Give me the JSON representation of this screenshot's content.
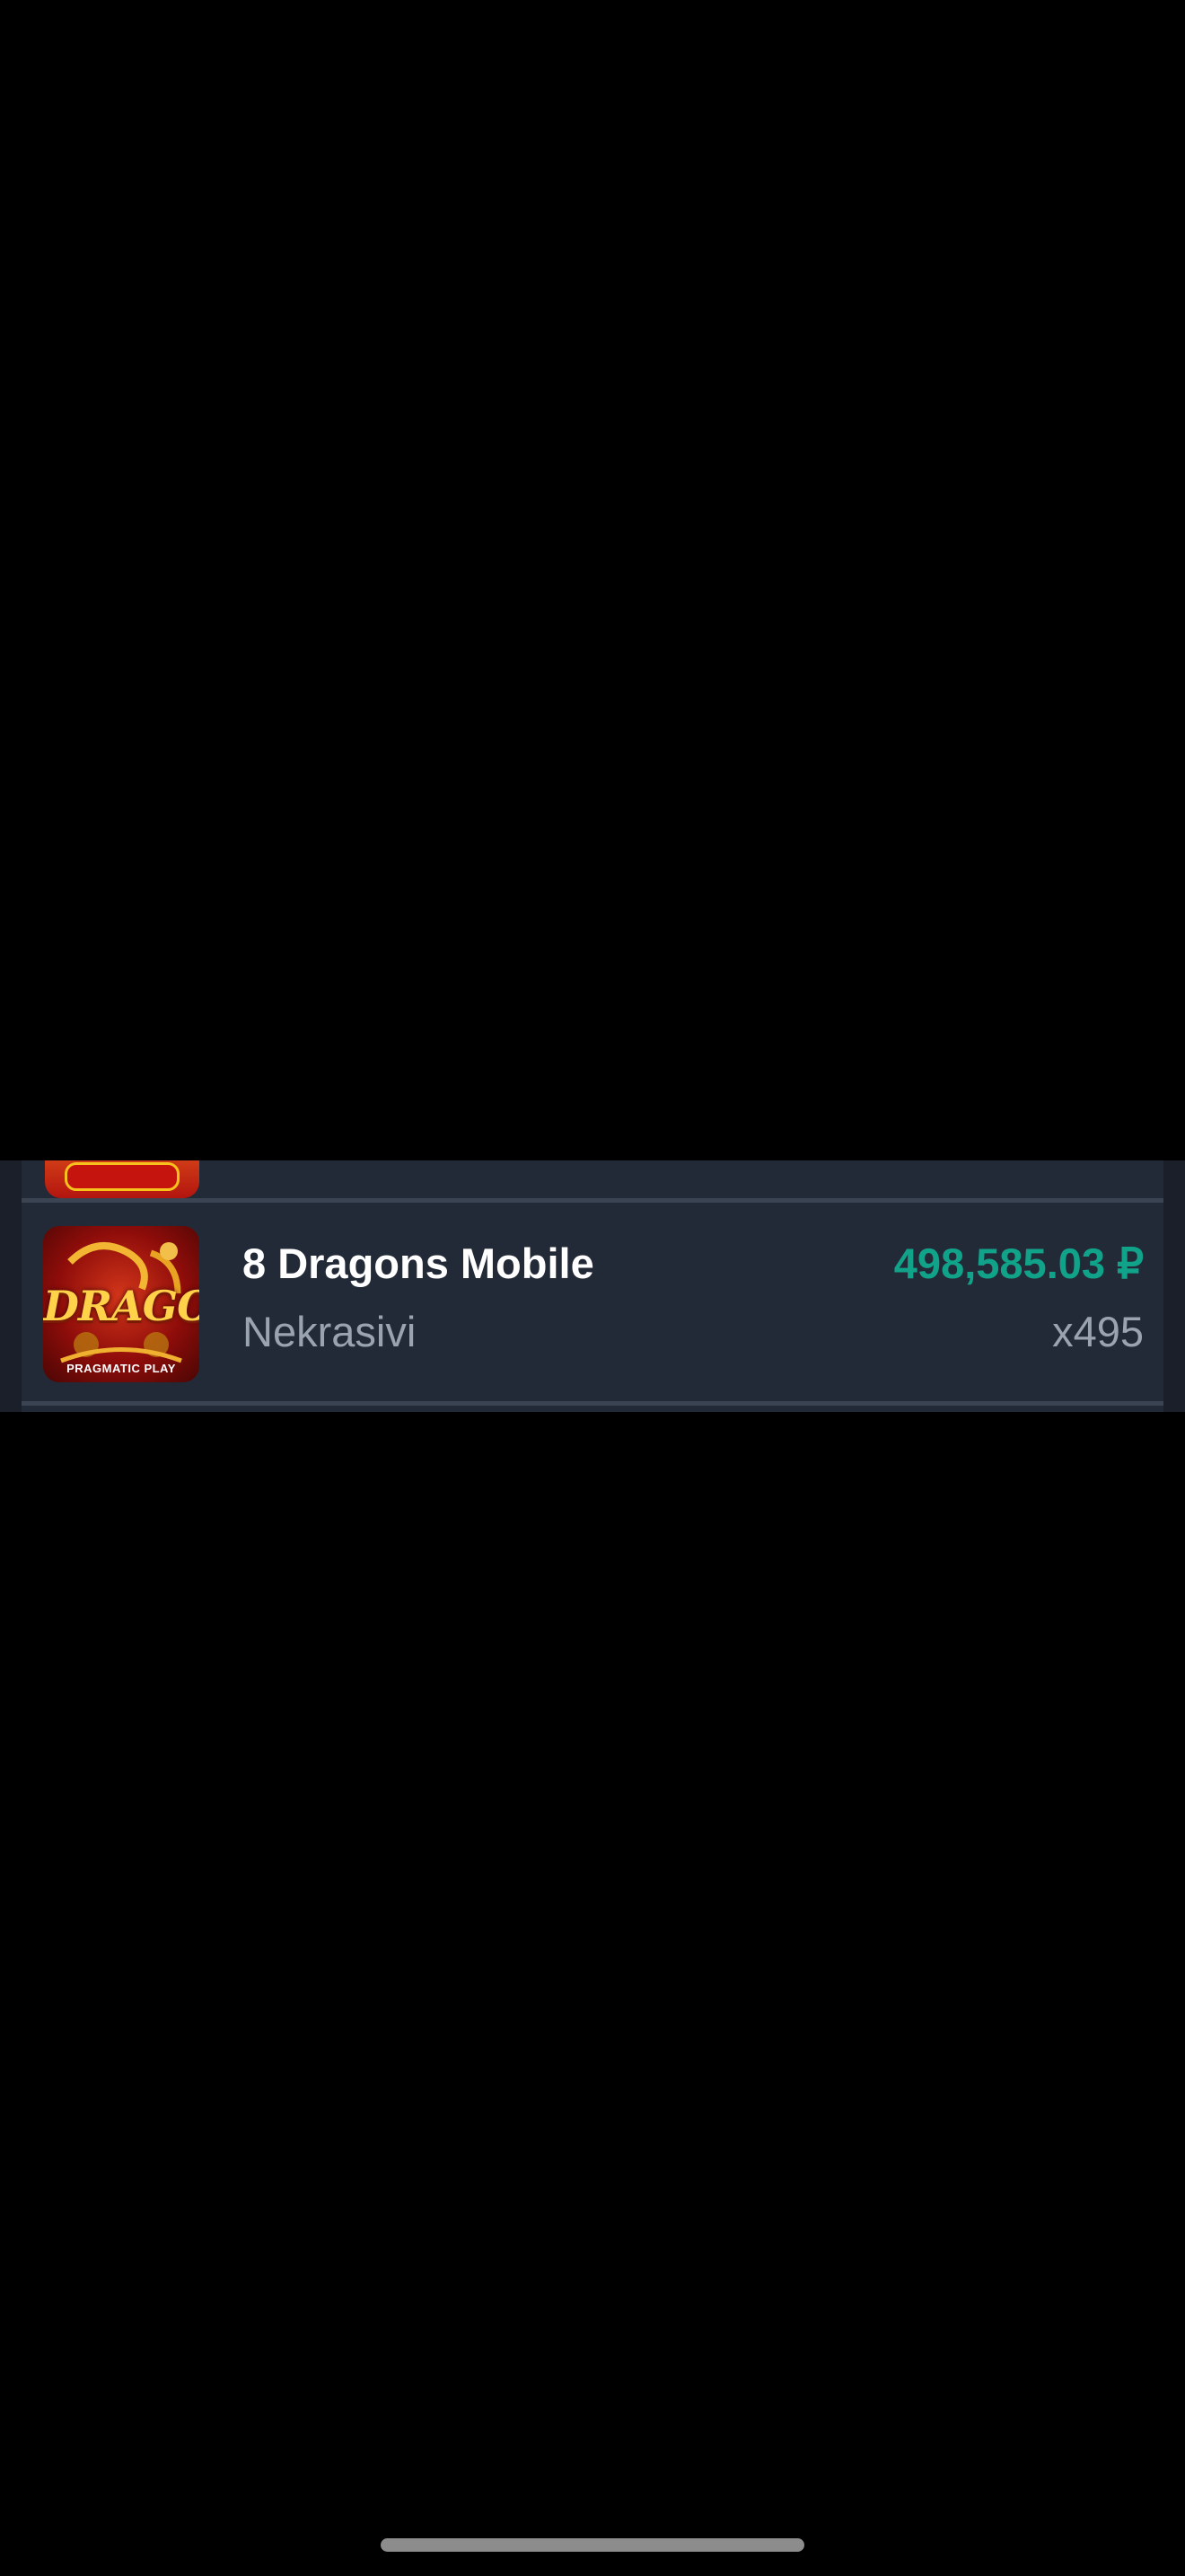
{
  "wins_feed": {
    "rows": [
      {
        "game_title": "8 Dragons Mobile",
        "player": "Nekrasivi",
        "win_amount": "498,585.03 ₽",
        "multiplier": "x495",
        "thumbnail": {
          "logo_text": "DRAGONS",
          "provider_text": "PRAGMATIC PLAY"
        }
      }
    ]
  },
  "colors": {
    "background": "#000000",
    "card": "#232a37",
    "divider": "#3a4453",
    "win_amount": "#11a38a",
    "secondary_text": "#9aa3b0",
    "title_text": "#ffffff"
  },
  "icons": {
    "previous_thumbnail": "game-thumbnail-partial",
    "home_indicator": "home-indicator-bar"
  }
}
